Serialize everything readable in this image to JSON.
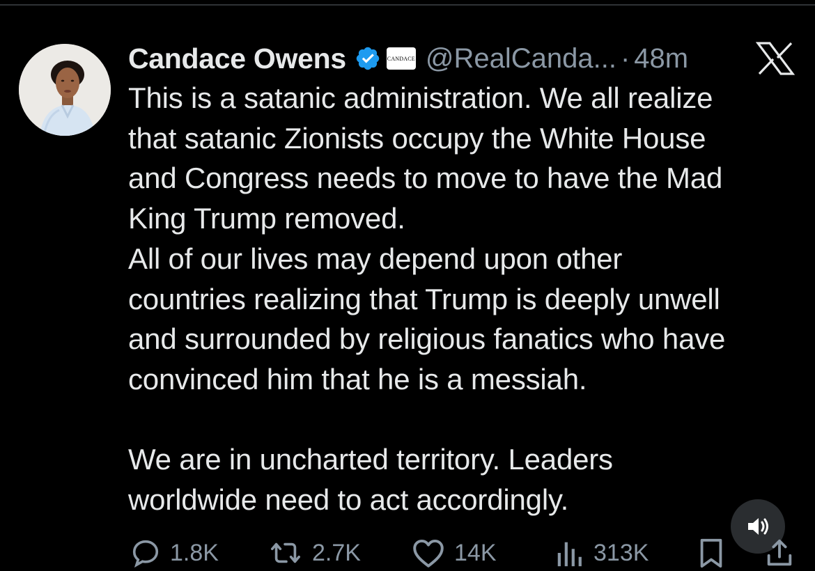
{
  "post": {
    "author": {
      "display_name": "Candace Owens",
      "handle": "@RealCanda...",
      "affiliate_badge_text": "CANDACE",
      "verified": true
    },
    "separator": "·",
    "time_ago": "48m",
    "text_lines": [
      "This is a satanic administration. We all realize",
      "that satanic Zionists occupy the White House",
      "and Congress needs to move to have the Mad",
      "King Trump removed.",
      "All of our lives may depend upon other",
      "countries realizing that Trump is deeply unwell",
      "and surrounded by religious fanatics who have",
      "convinced him that he is a messiah.",
      "",
      "We are in uncharted territory. Leaders",
      "worldwide need to act accordingly."
    ]
  },
  "actions": {
    "replies": "1.8K",
    "reposts": "2.7K",
    "likes": "14K",
    "views": "313K"
  },
  "icons": {
    "logo": "x-logo-icon",
    "verified": "verified-badge-icon",
    "reply": "reply-icon",
    "repost": "repost-icon",
    "like": "heart-icon",
    "views": "views-icon",
    "bookmark": "bookmark-icon",
    "share": "share-icon",
    "sound": "speaker-icon"
  },
  "colors": {
    "background": "#000000",
    "text": "#e7e9ea",
    "secondary_text": "#8b98a5",
    "verified_blue": "#1d9bf0"
  }
}
